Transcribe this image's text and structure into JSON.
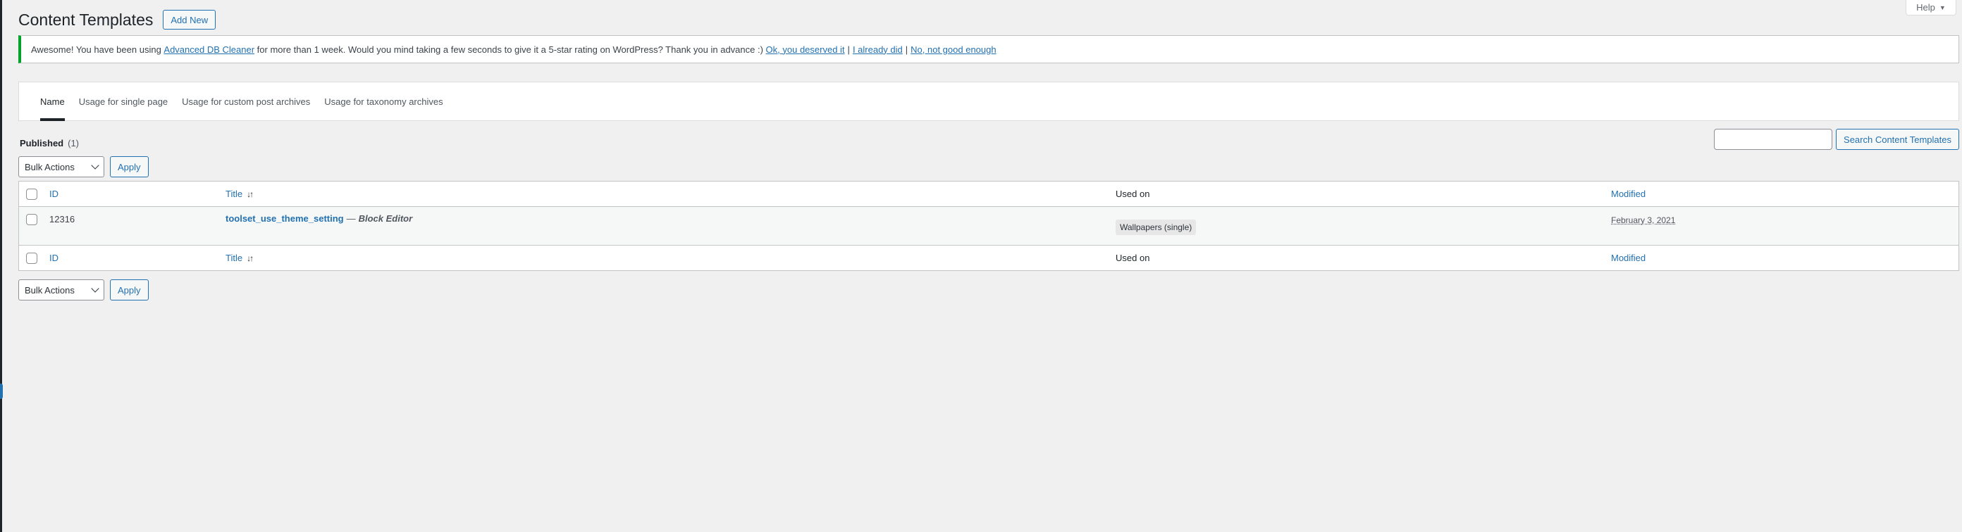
{
  "header": {
    "title": "Content Templates",
    "add_new_label": "Add New",
    "help_label": "Help"
  },
  "notice": {
    "text_before": "Awesome! You have been using ",
    "plugin_link": "Advanced DB Cleaner",
    "text_after": " for more than 1 week. Would you mind taking a few seconds to give it a 5-star rating on WordPress? Thank you in advance :) ",
    "link_ok": "Ok, you deserved it",
    "link_did": "I already did",
    "link_no": "No, not good enough",
    "separator": "|"
  },
  "tabs": [
    {
      "label": "Name",
      "active": true
    },
    {
      "label": "Usage for single page"
    },
    {
      "label": "Usage for custom post archives"
    },
    {
      "label": "Usage for taxonomy archives"
    }
  ],
  "filter": {
    "label": "Published",
    "count": "(1)"
  },
  "search": {
    "button_label": "Search Content Templates",
    "placeholder": ""
  },
  "bulk": {
    "select_value": "Bulk Actions",
    "apply_label": "Apply"
  },
  "table": {
    "columns": {
      "id": "ID",
      "title": "Title",
      "used_on": "Used on",
      "modified": "Modified"
    },
    "rows": [
      {
        "id": "12316",
        "title": "toolset_use_theme_setting",
        "title_separator": "—",
        "editor": "Block Editor",
        "used_on": "Wallpapers (single)",
        "modified": "February 3, 2021"
      }
    ]
  },
  "icons": {
    "sort": "sort-icon",
    "caret": "caret-down-icon"
  },
  "colors": {
    "accent": "#2271b1",
    "notice_success": "#00a32a",
    "background": "#f0f0f1"
  }
}
